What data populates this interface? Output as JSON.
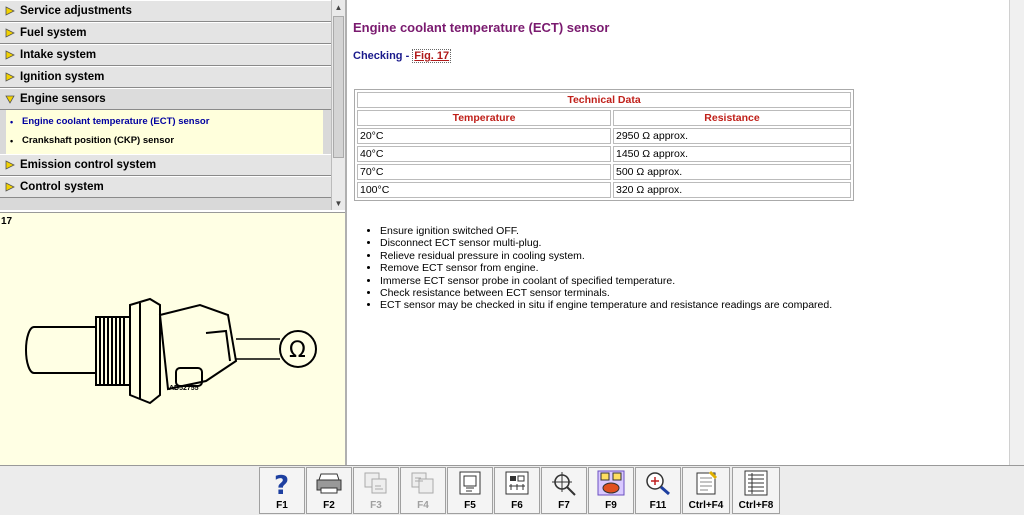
{
  "nav": {
    "items_top": [
      {
        "label": "Service adjustments"
      },
      {
        "label": "Fuel system"
      },
      {
        "label": "Intake system"
      },
      {
        "label": "Ignition system"
      }
    ],
    "open_group": {
      "label": "Engine sensors",
      "sub_items": [
        {
          "label": "Engine coolant temperature (ECT) sensor",
          "active": true
        },
        {
          "label": "Crankshaft position (CKP) sensor",
          "active": false
        }
      ]
    },
    "items_bottom": [
      {
        "label": "Emission control system"
      },
      {
        "label": "Control system"
      }
    ]
  },
  "figure": {
    "number": "17",
    "code": "AD52755"
  },
  "content": {
    "title": "Engine coolant temperature (ECT) sensor",
    "checking_label": "Checking",
    "checking_sep": " - ",
    "fig_link": "Fig. 17",
    "table": {
      "caption": "Technical Data",
      "headers": [
        "Temperature",
        "Resistance"
      ],
      "rows": [
        [
          "20°C",
          "2950 Ω approx."
        ],
        [
          "40°C",
          "1450 Ω approx."
        ],
        [
          "70°C",
          "500 Ω approx."
        ],
        [
          "100°C",
          "320 Ω approx."
        ]
      ]
    },
    "steps": [
      "Ensure ignition switched OFF.",
      "Disconnect ECT sensor multi-plug.",
      "Relieve residual pressure in cooling system.",
      "Remove ECT sensor from engine.",
      "Immerse ECT sensor probe in coolant of specified temperature.",
      "Check resistance between ECT sensor terminals.",
      "ECT sensor may be checked in situ if engine temperature and resistance readings are compared."
    ]
  },
  "toolbar": {
    "buttons": [
      {
        "label": "F1",
        "icon": "help-icon",
        "enabled": true
      },
      {
        "label": "F2",
        "icon": "printer-icon",
        "enabled": true
      },
      {
        "label": "F3",
        "icon": "back-pages-icon",
        "enabled": false
      },
      {
        "label": "F4",
        "icon": "forward-pages-icon",
        "enabled": false
      },
      {
        "label": "F5",
        "icon": "component-icon",
        "enabled": true
      },
      {
        "label": "F6",
        "icon": "wiring-icon",
        "enabled": true
      },
      {
        "label": "F7",
        "icon": "crosshair-icon",
        "enabled": true
      },
      {
        "label": "F9",
        "icon": "numbered-tiles-icon",
        "enabled": true
      },
      {
        "label": "F11",
        "icon": "search-text-icon",
        "enabled": true
      },
      {
        "label": "Ctrl+F4",
        "icon": "notes-icon",
        "enabled": true
      },
      {
        "label": "Ctrl+F8",
        "icon": "list-icon",
        "enabled": true
      }
    ]
  }
}
